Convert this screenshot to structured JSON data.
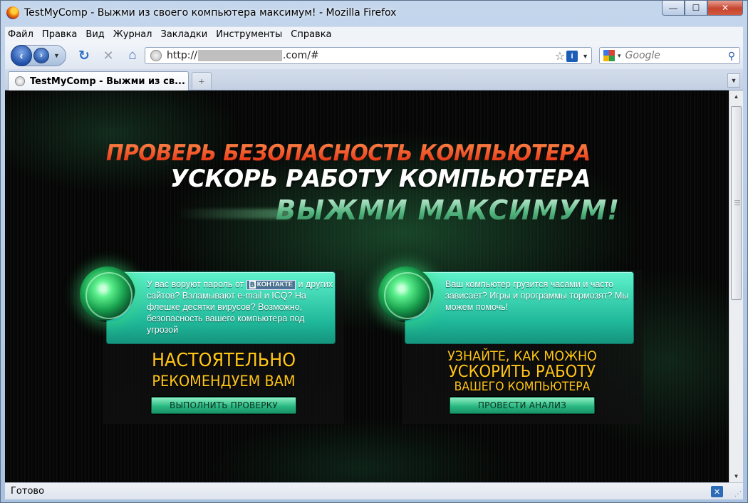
{
  "window": {
    "title": "TestMyComp - Выжми из своего компьютера максимум! - Mozilla Firefox"
  },
  "menu": [
    "Файл",
    "Правка",
    "Вид",
    "Журнал",
    "Закладки",
    "Инструменты",
    "Справка"
  ],
  "address": {
    "prefix": "http://",
    "suffix": ".com/#"
  },
  "search": {
    "placeholder": "Google"
  },
  "tab": {
    "label": "TestMyComp - Выжми из св..."
  },
  "page": {
    "headline1": "ПРОВЕРЬ БЕЗОПАСНОСТЬ КОМПЬЮТЕРА",
    "headline2": "УСКОРЬ РАБОТУ КОМПЬЮТЕРА",
    "headline3": "ВЫЖМИ МАКСИМУМ!",
    "left": {
      "text_before_badge": "У вас воруют пароль от ",
      "badge_b": "B",
      "badge_text": "КОНТАКТЕ",
      "text_after_badge": " и других сайтов? Взламывают e-mail и ICQ? На флешке десятки вирусов? Возможно, безопасность вашего компьютера под угрозой",
      "cta_line1": "НАСТОЯТЕЛЬНО",
      "cta_line2": "РЕКОМЕНДУЕМ ВАМ",
      "button": "ВЫПОЛНИТЬ ПРОВЕРКУ"
    },
    "right": {
      "text": "Ваш компьютер грузится часами и часто зависает? Игры и программы тормозят? Мы можем помочь!",
      "cta_line1": "УЗНАЙТЕ, КАК МОЖНО",
      "cta_line2": "УСКОРИТЬ РАБОТУ",
      "cta_line3": "ВАШЕГО КОМПЬЮТЕРА",
      "button": "ПРОВЕСТИ АНАЛИЗ"
    }
  },
  "status": {
    "text": "Готово"
  },
  "colors": {
    "headline_red": "#ff4a1c",
    "cta_yellow": "#ffc517",
    "teal_box": "#1fb89a"
  }
}
